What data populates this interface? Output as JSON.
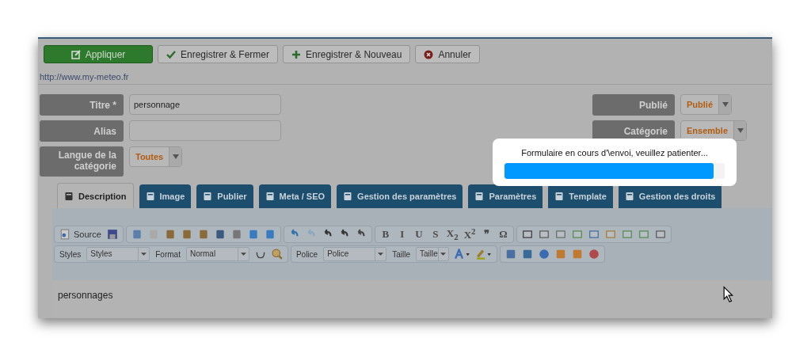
{
  "toolbar": {
    "buttons": [
      {
        "label": "Appliquer",
        "kind": "primary"
      },
      {
        "label": "Enregistrer & Fermer",
        "kind": "check"
      },
      {
        "label": "Enregistrer & Nouveau",
        "kind": "plus"
      },
      {
        "label": "Annuler",
        "kind": "cancel"
      }
    ]
  },
  "site_url": "http://www.my-meteo.fr",
  "form": {
    "left": [
      {
        "label": "Titre *",
        "kind": "input",
        "value": "personnage"
      },
      {
        "label": "Alias",
        "kind": "input"
      },
      {
        "label": "Langue de la catégorie",
        "kind": "select",
        "value": "Toutes"
      }
    ],
    "right": [
      {
        "label": "Publié",
        "kind": "select",
        "value": "Publié"
      },
      {
        "label": "Catégorie",
        "kind": "select",
        "value": "Ensemble"
      }
    ]
  },
  "tabs": [
    {
      "label": "Description",
      "selected": true
    },
    {
      "label": "Image",
      "selected": false
    },
    {
      "label": "Publier",
      "selected": false
    },
    {
      "label": "Meta / SEO",
      "selected": false
    },
    {
      "label": "Gestion des paramètres",
      "selected": false
    },
    {
      "label": "Paramètres",
      "selected": false
    },
    {
      "label": "Template",
      "selected": false
    },
    {
      "label": "Gestion des droits",
      "selected": false
    }
  ],
  "editor": {
    "source_button": "Source",
    "format_buttons": [
      "B",
      "I",
      "U",
      "S",
      "X$_{2}$",
      "X$^{2}$",
      "❞",
      "Ω"
    ],
    "selects": [
      {
        "label": "Styles",
        "value": "Styles"
      },
      {
        "label": "Format",
        "value": "Normal"
      },
      {
        "label": "Police",
        "value": "Police"
      },
      {
        "label": "Taille",
        "value": "Taille"
      }
    ],
    "content": "personnages"
  },
  "modal": {
    "message": "Formulaire en cours d'\\envoi, veuillez patienter...",
    "level": 0.95
  }
}
